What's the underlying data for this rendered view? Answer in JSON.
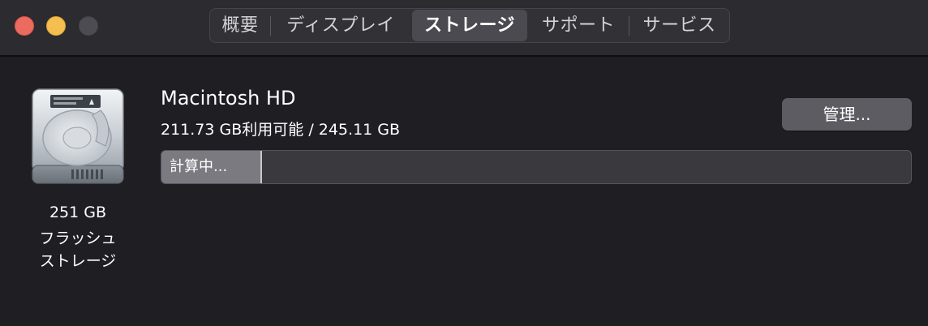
{
  "tabs": [
    {
      "label": "概要",
      "selected": false
    },
    {
      "label": "ディスプレイ",
      "selected": false
    },
    {
      "label": "ストレージ",
      "selected": true
    },
    {
      "label": "サポート",
      "selected": false
    },
    {
      "label": "サービス",
      "selected": false
    }
  ],
  "disk": {
    "capacity": "251 GB",
    "type_line1": "フラッシュ",
    "type_line2": "ストレージ",
    "icon": "hard-drive-icon"
  },
  "volume": {
    "name": "Macintosh HD",
    "usage": "211.73 GB利用可能 / 245.11 GB",
    "manage_label": "管理...",
    "bar_segment_label": "計算中..."
  },
  "colors": {
    "close": "#ed6a5e",
    "minimize": "#f4bf4f",
    "zoom": "#4d4c52",
    "background": "#1f1e23"
  }
}
